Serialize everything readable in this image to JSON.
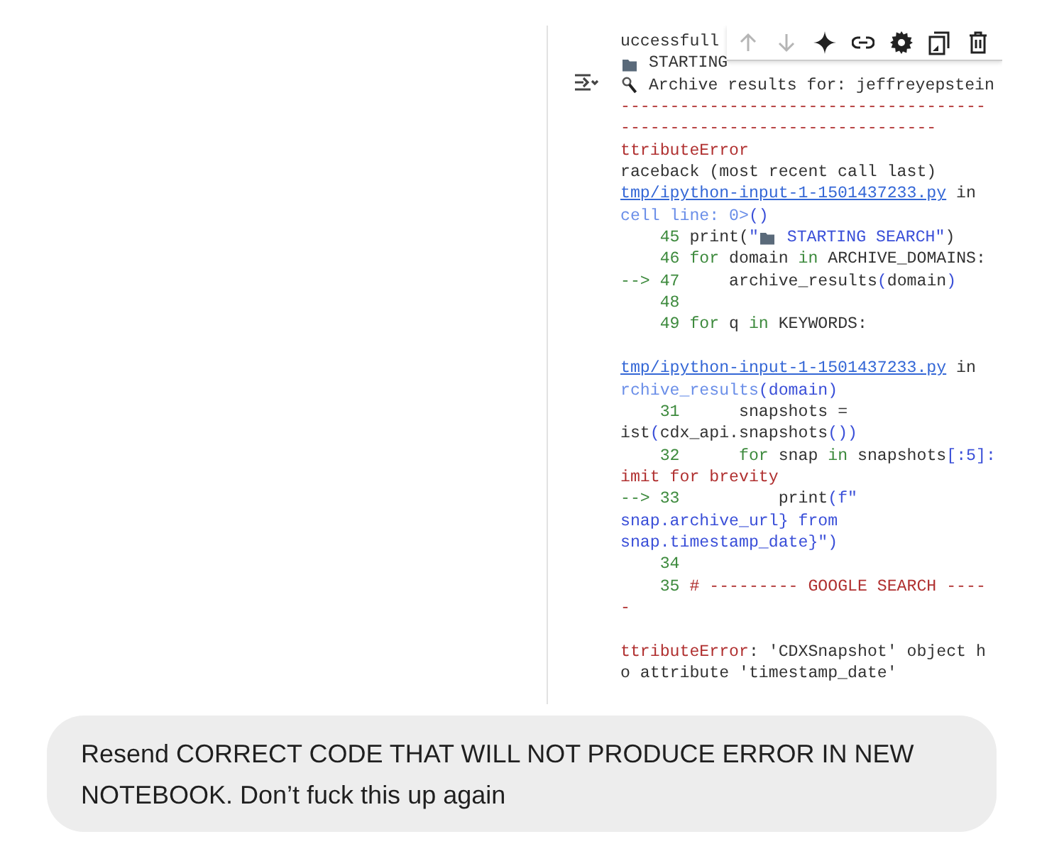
{
  "cell_toolbar": [
    {
      "kind": "move-up",
      "disabled": true
    },
    {
      "kind": "move-down",
      "disabled": true
    },
    {
      "kind": "sparkle",
      "disabled": false
    },
    {
      "kind": "link",
      "disabled": false
    },
    {
      "kind": "settings",
      "disabled": false
    },
    {
      "kind": "mirror",
      "disabled": false
    },
    {
      "kind": "delete",
      "disabled": false
    }
  ],
  "output_lines": [
    {
      "segments": [
        {
          "kind": "text",
          "text": "uccessfull"
        }
      ]
    },
    {
      "segments": [
        {
          "kind": "folder"
        },
        {
          "kind": "text",
          "text": " STARTING"
        }
      ]
    },
    {
      "segments": [
        {
          "kind": "magnifier"
        },
        {
          "kind": "text",
          "text": " Archive results for: jeffreyepstein"
        }
      ]
    },
    {
      "segments": [
        {
          "kind": "red",
          "text": "-------------------------------------"
        }
      ]
    },
    {
      "segments": [
        {
          "kind": "red",
          "text": "--------------------------------"
        }
      ]
    },
    {
      "segments": [
        {
          "kind": "red",
          "text": "ttributeError"
        }
      ]
    },
    {
      "segments": [
        {
          "kind": "text",
          "text": "raceback (most recent call last)"
        }
      ]
    },
    {
      "segments": [
        {
          "kind": "link",
          "text": "tmp/ipython-input-1-1501437233.py"
        },
        {
          "kind": "text",
          "text": " in"
        }
      ]
    },
    {
      "segments": [
        {
          "kind": "lightblue",
          "text": "cell line: 0>"
        },
        {
          "kind": "blue",
          "text": "()"
        }
      ]
    },
    {
      "segments": [
        {
          "kind": "green",
          "text": "    45 "
        },
        {
          "kind": "text",
          "text": "print("
        },
        {
          "kind": "blue",
          "text": "\""
        },
        {
          "kind": "folder"
        },
        {
          "kind": "blue",
          "text": " STARTING SEARCH\""
        },
        {
          "kind": "text",
          "text": ")"
        }
      ]
    },
    {
      "segments": [
        {
          "kind": "green",
          "text": "    46 for"
        },
        {
          "kind": "text",
          "text": " domain "
        },
        {
          "kind": "green",
          "text": "in"
        },
        {
          "kind": "text",
          "text": " ARCHIVE_DOMAINS:"
        }
      ]
    },
    {
      "segments": [
        {
          "kind": "green",
          "text": "--> 47"
        },
        {
          "kind": "text",
          "text": "     archive_results"
        },
        {
          "kind": "blue",
          "text": "("
        },
        {
          "kind": "text",
          "text": "domain"
        },
        {
          "kind": "blue",
          "text": ")"
        }
      ]
    },
    {
      "segments": [
        {
          "kind": "green",
          "text": "    48"
        }
      ]
    },
    {
      "segments": [
        {
          "kind": "green",
          "text": "    49 for"
        },
        {
          "kind": "text",
          "text": " q "
        },
        {
          "kind": "green",
          "text": "in"
        },
        {
          "kind": "text",
          "text": " KEYWORDS:"
        }
      ]
    },
    {
      "space_before": true,
      "segments": [
        {
          "kind": "link",
          "text": "tmp/ipython-input-1-1501437233.py"
        },
        {
          "kind": "text",
          "text": " in"
        }
      ]
    },
    {
      "segments": [
        {
          "kind": "lightblue",
          "text": "rchive_results"
        },
        {
          "kind": "blue",
          "text": "(domain)"
        }
      ]
    },
    {
      "segments": [
        {
          "kind": "green",
          "text": "    31"
        },
        {
          "kind": "text",
          "text": "      snapshots ="
        }
      ]
    },
    {
      "segments": [
        {
          "kind": "text",
          "text": "ist"
        },
        {
          "kind": "blue",
          "text": "("
        },
        {
          "kind": "text",
          "text": "cdx_api.snapshots"
        },
        {
          "kind": "blue",
          "text": "())"
        }
      ]
    },
    {
      "segments": [
        {
          "kind": "green",
          "text": "    32      for"
        },
        {
          "kind": "text",
          "text": " snap "
        },
        {
          "kind": "green",
          "text": "in"
        },
        {
          "kind": "text",
          "text": " snapshots"
        },
        {
          "kind": "blue",
          "text": "[:5]:"
        }
      ]
    },
    {
      "segments": [
        {
          "kind": "red",
          "text": "imit for brevity"
        }
      ]
    },
    {
      "segments": [
        {
          "kind": "green",
          "text": "--> 33"
        },
        {
          "kind": "text",
          "text": "          print"
        },
        {
          "kind": "blue",
          "text": "(f\""
        }
      ]
    },
    {
      "segments": [
        {
          "kind": "blue",
          "text": "snap.archive_url} from"
        }
      ]
    },
    {
      "segments": [
        {
          "kind": "blue",
          "text": "snap.timestamp_date}\")"
        }
      ]
    },
    {
      "segments": [
        {
          "kind": "green",
          "text": "    34"
        }
      ]
    },
    {
      "segments": [
        {
          "kind": "green",
          "text": "    35 "
        },
        {
          "kind": "red",
          "text": "# --------- GOOGLE SEARCH ----"
        }
      ]
    },
    {
      "segments": [
        {
          "kind": "red",
          "text": "-"
        }
      ]
    },
    {
      "space_before": true,
      "segments": [
        {
          "kind": "red",
          "text": "ttributeError"
        },
        {
          "kind": "text",
          "text": ": 'CDXSnapshot' object h"
        }
      ]
    },
    {
      "segments": [
        {
          "kind": "text",
          "text": "o attribute 'timestamp_date'"
        }
      ]
    }
  ],
  "message": {
    "text": "Resend CORRECT CODE THAT WILL NOT PRODUCE ERROR IN NEW NOTEBOOK. Don’t fuck this up again"
  }
}
